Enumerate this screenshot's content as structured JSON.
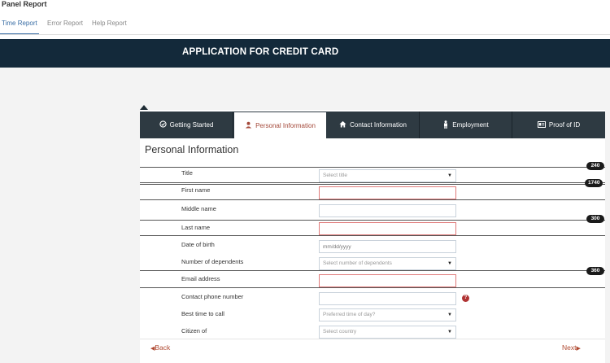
{
  "panel": {
    "title": "Panel Report",
    "tabs": [
      {
        "label": "Time Report",
        "active": true
      },
      {
        "label": "Error Report",
        "active": false
      },
      {
        "label": "Help Report",
        "active": false
      }
    ]
  },
  "banner": {
    "title": "APPLICATION FOR CREDIT CARD"
  },
  "steps": [
    {
      "label": "Getting Started",
      "icon": "check-circle-icon",
      "active": false
    },
    {
      "label": "Personal Information",
      "icon": "user-icon",
      "active": true
    },
    {
      "label": "Contact Information",
      "icon": "home-icon",
      "active": false
    },
    {
      "label": "Employment",
      "icon": "person-icon",
      "active": false
    },
    {
      "label": "Proof of ID",
      "icon": "id-card-icon",
      "active": false
    }
  ],
  "section": {
    "heading": "Personal Information"
  },
  "fields": [
    {
      "label": "Title",
      "value": "",
      "placeholder": "Select title",
      "type": "select"
    },
    {
      "label": "First name",
      "value": "",
      "placeholder": "",
      "type": "text",
      "required": true
    },
    {
      "label": "Middle name",
      "value": "",
      "placeholder": "",
      "type": "text"
    },
    {
      "label": "Last name",
      "value": "",
      "placeholder": "",
      "type": "text",
      "required": true
    },
    {
      "label": "Date of birth",
      "value": "",
      "placeholder": "mm/dd/yyyy",
      "type": "text"
    },
    {
      "label": "Number of dependents",
      "value": "",
      "placeholder": "Select number of dependents",
      "type": "select"
    },
    {
      "label": "Email address",
      "value": "",
      "placeholder": "",
      "type": "text",
      "required": true
    },
    {
      "label": "Contact phone number",
      "value": "",
      "placeholder": "",
      "type": "text"
    },
    {
      "label": "Best time to call",
      "value": "",
      "placeholder": "Preferred time of day?",
      "type": "select"
    },
    {
      "label": "Citizen of",
      "value": "",
      "placeholder": "Select country",
      "type": "select"
    }
  ],
  "badges": [
    "240",
    "1740",
    "300",
    "360"
  ],
  "nav": {
    "back_label": "Back",
    "next_label": "Next"
  },
  "colors": {
    "banner": "#13293a",
    "step_bar": "#2e3a42",
    "accent": "#a4493a",
    "required_border": "#e07a7a",
    "link": "#3a6ea5"
  }
}
